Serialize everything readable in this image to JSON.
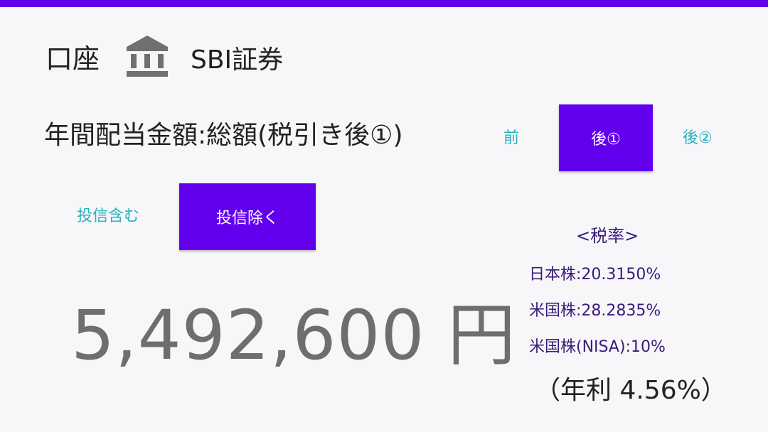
{
  "header": {
    "account_label": "口座",
    "account_icon": "bank-icon",
    "broker_name": "SBI証券"
  },
  "dividend": {
    "title": "年間配当金額:総額(税引き後①)",
    "tax_options": [
      "前",
      "後①",
      "後②"
    ],
    "selected_tax_option": "後①",
    "fund_options": [
      "投信含む",
      "投信除く"
    ],
    "selected_fund_option": "投信除く",
    "amount": "5,492,600 円",
    "annual_yield": "（年利 4.56%）"
  },
  "tax_rates": {
    "header": "<税率>",
    "rows": [
      "日本株:20.3150%",
      "米国株:28.2835%",
      "米国株(NISA):10%"
    ]
  },
  "colors": {
    "accent": "#6200ee",
    "text_button": "#23b2bf",
    "tax_text": "#3a1a7a",
    "amount_text": "#6e6e6e"
  }
}
